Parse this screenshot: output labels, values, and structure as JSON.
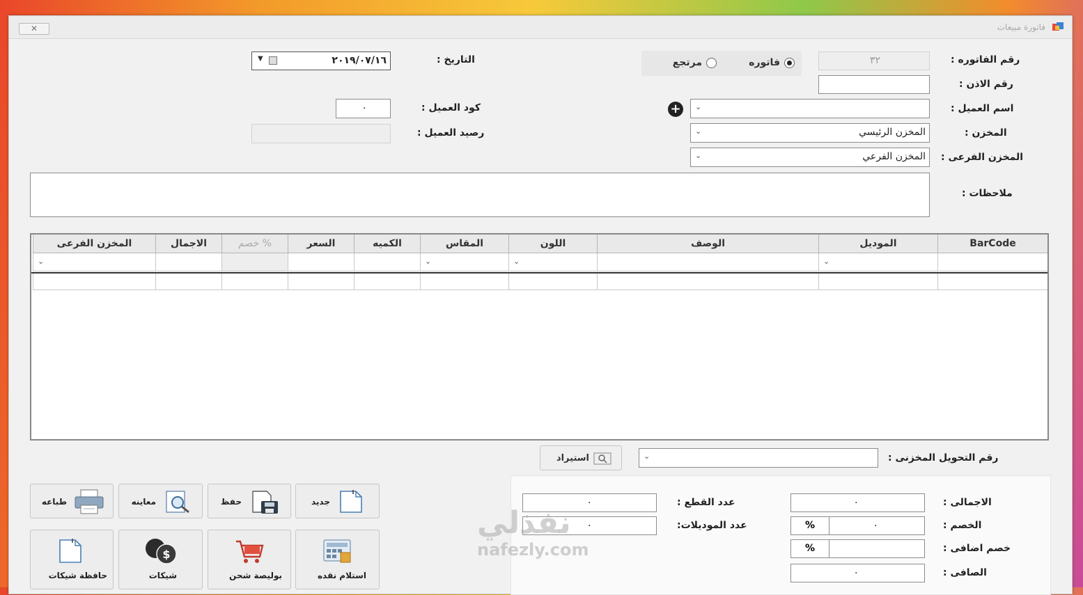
{
  "window": {
    "title": "فاتورة مبيعات",
    "close_label": "✕"
  },
  "fields": {
    "invoice_number_label": "رقم الفاتوره :",
    "invoice_number_value": "٣٢",
    "permit_number_label": "رقم الاذن :",
    "permit_number_value": "",
    "customer_name_label": "اسم العميل :",
    "customer_name_value": "",
    "store_label": "المخزن :",
    "store_value": "المخزن الرئيسي",
    "sub_store_label": "المخزن الفرعى :",
    "sub_store_value": "المخزن الفرعي",
    "notes_label": "ملاحظات :",
    "date_label": "التاريخ :",
    "date_value": "٢٠١٩/٠٧/١٦",
    "customer_code_label": "كود العميل :",
    "customer_code_value": "٠",
    "customer_balance_label": "رصيد العميل :",
    "customer_balance_value": ""
  },
  "invoice_type": {
    "invoice": "فاتوره",
    "return": "مرتجع",
    "selected": "invoice"
  },
  "grid": {
    "columns": [
      "BarCode",
      "الموديل",
      "الوصف",
      "اللون",
      "المقاس",
      "الكميه",
      "السعر",
      "خصم %",
      "الاجمال",
      "المخزن الفرعى"
    ]
  },
  "transfer": {
    "label": "رقم التحويل المخزنى :",
    "value": "",
    "import_label": "استيراد"
  },
  "summary": {
    "total_label": "الاجمالى :",
    "total_value": "٠",
    "discount_label": "الخصم :",
    "discount_value": "٠",
    "discount_unit": "%",
    "extra_discount_label": "خصم اضافى :",
    "extra_discount_value": "",
    "extra_discount_unit": "%",
    "net_label": "الصافى :",
    "net_value": "٠",
    "pieces_label": "عدد القطع :",
    "pieces_value": "٠",
    "models_label": "عدد الموديلات:",
    "models_value": "٠"
  },
  "buttons": {
    "new": "جديد",
    "save": "حفظ",
    "preview": "معاينه",
    "print": "طباعه",
    "cash_receipt": "استلام نقده",
    "shipping_policy": "بوليصة شحن",
    "cheques": "شيكات",
    "cheque_wallet": "حافظة شيكات"
  },
  "watermark": {
    "brand": "نفذلي",
    "url": "nafezly.com"
  }
}
